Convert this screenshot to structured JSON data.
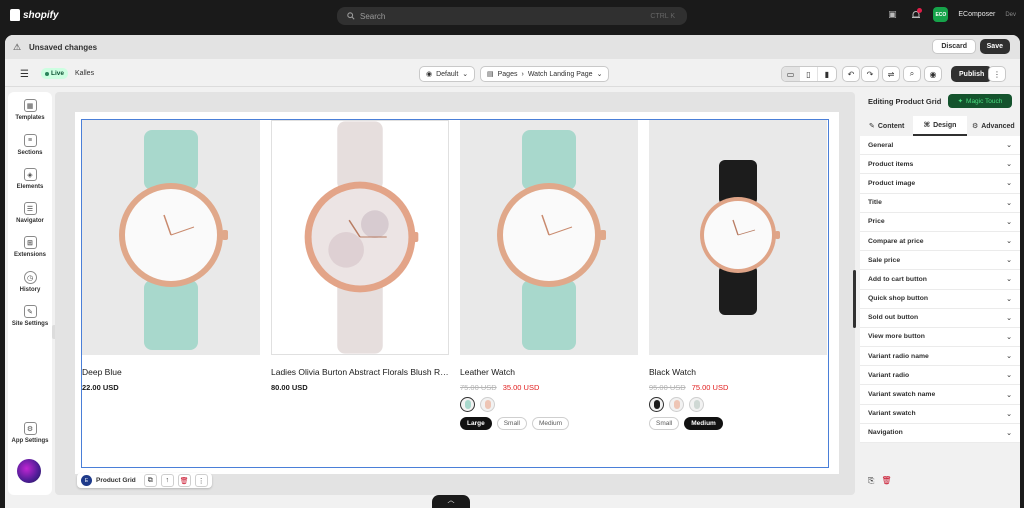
{
  "topbar": {
    "brand": "shopify",
    "search_placeholder": "Search",
    "search_shortcut": "CTRL K",
    "store_badge": "ECO",
    "store_name": "EComposer",
    "store_sub": "Dev"
  },
  "unsaved": {
    "message": "Unsaved changes",
    "discard_label": "Discard",
    "save_label": "Save"
  },
  "toolbar": {
    "live_label": "Live",
    "theme_name": "Kalles",
    "language_select": "Default",
    "pages_label": "Pages",
    "page_name": "Watch Landing Page",
    "publish_label": "Publish"
  },
  "left_rail": {
    "items": [
      {
        "label": "Templates"
      },
      {
        "label": "Sections"
      },
      {
        "label": "Elements"
      },
      {
        "label": "Navigator"
      },
      {
        "label": "Extensions"
      },
      {
        "label": "History"
      },
      {
        "label": "Site Settings"
      }
    ],
    "app_settings": "App Settings"
  },
  "products": [
    {
      "title": "Deep Blue",
      "price": "22.00 USD",
      "strap": "#a8d8cc",
      "case": "#e0a88a"
    },
    {
      "title": "Ladies Olivia Burton Abstract Florals Blush Rose Gold",
      "price": "80.00 USD",
      "strap": "#e6dedd",
      "case": "#e3a488"
    },
    {
      "title": "Leather Watch",
      "compare_price": "75.00 USD",
      "price": "35.00 USD",
      "strap": "#a8d8cc",
      "case": "#e0a88a",
      "sizes": [
        {
          "label": "Large",
          "active": true
        },
        {
          "label": "Small",
          "active": false
        },
        {
          "label": "Medium",
          "active": false
        }
      ]
    },
    {
      "title": "Black Watch",
      "compare_price": "95.00 USD",
      "price": "75.00 USD",
      "strap": "#1c1c1c",
      "case": "#dfa487",
      "sizes": [
        {
          "label": "Small",
          "active": false
        },
        {
          "label": "Medium",
          "active": true
        }
      ]
    }
  ],
  "selection": {
    "label": "Product Grid"
  },
  "right_panel": {
    "heading": "Editing Product Grid",
    "magic_label": "Magic Touch",
    "tabs": [
      "Content",
      "Design",
      "Advanced"
    ],
    "active_tab": "Design",
    "sections": [
      "General",
      "Product items",
      "Product image",
      "Title",
      "Price",
      "Compare at price",
      "Sale price",
      "Add to cart button",
      "Quick shop button",
      "Sold out button",
      "View more button",
      "Variant radio name",
      "Variant radio",
      "Variant swatch name",
      "Variant swatch",
      "Navigation"
    ]
  },
  "colors": {
    "accent": "#4a7fd8",
    "sale": "#e11d1d",
    "magic": "#4ade80",
    "live": "#cdfee1"
  }
}
